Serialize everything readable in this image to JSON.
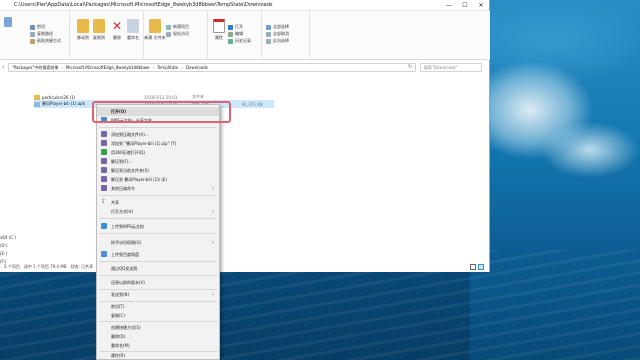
{
  "window": {
    "title": "C:\\Users\\Pier\\AppData\\Local\\Packages\\Microsoft.MicrosoftEdge_8wekyb3d8bbwe\\TempState\\Downloads",
    "min": "—",
    "max": "☐",
    "close": "✕"
  },
  "ribbon": {
    "clipboard_small": [
      "剪切",
      "复制路径",
      "粘贴快捷方式"
    ],
    "move_to": "移动到",
    "copy_to": "复制到",
    "delete": "删除",
    "rename": "重命名",
    "new_folder": "新建\n文件夹",
    "new_small": [
      "新建项目",
      "轻松访问"
    ],
    "properties": "属性",
    "open_small": [
      "打开",
      "编辑",
      "历史记录"
    ],
    "select_small": [
      "全部选择",
      "全部取消",
      "反向选择"
    ],
    "colors": {
      "delete": "#d42a2a",
      "folder": "#e8b84a",
      "accent": "#2b7cd3"
    }
  },
  "address": {
    "crumbs": [
      "\"Packages\"中的搜索结果",
      "Microsoft.MicrosoftEdge_8wekyb3d8bbwe",
      "TempState",
      "Downloads"
    ],
    "search_placeholder": "搜索\"Downloads\""
  },
  "files": [
    {
      "name": "particulars26 (1)",
      "date": "2019/3/12 20:03",
      "type": "文件夹",
      "size": "",
      "selected": false
    },
    {
      "name": "暴风Player-bili (1).apk",
      "date": "2019/3/26 14:29",
      "type": "APK 文件",
      "size": "81,371 KB",
      "selected": true
    }
  ],
  "navpane": [
    "x64 (C:)",
    "(D:)",
    "(E:)",
    "(F:)"
  ],
  "status": {
    "count": "2 个项目",
    "selected": "选中 1 个项目  79.4 MB",
    "state": "状态: 已共享"
  },
  "context_menu": {
    "items": [
      {
        "label": "打开(O)",
        "bold": true,
        "hl": true
      },
      {
        "label": "WPS云文档 - 分享文件"
      },
      {
        "label": "添加到压缩文件(A)..."
      },
      {
        "label": "添加到 \"暴风Player-bili (1).zip\" (T)"
      },
      {
        "label": "用360压缩打开(Q)"
      },
      {
        "label": "解压到(F)..."
      },
      {
        "label": "解压到当前文件夹(X)"
      },
      {
        "label": "解压到 暴风Player-bili (1)\\ (E)"
      },
      {
        "label": "其他压缩命令",
        "sub": true
      },
      {
        "label": "共享"
      },
      {
        "label": "打开方式(H)",
        "sub": true
      },
      {
        "label": "上传到WPS云文档"
      },
      {
        "label": "授予访问权限(G)",
        "sub": true
      },
      {
        "label": "上传到百度网盘"
      },
      {
        "label": "通过QQ发送到"
      },
      {
        "label": "还原以前的版本(V)"
      },
      {
        "label": "发送到(N)",
        "sub": true
      },
      {
        "label": "剪切(T)"
      },
      {
        "label": "复制(C)"
      },
      {
        "label": "创建快捷方式(S)"
      },
      {
        "label": "删除(D)"
      },
      {
        "label": "重命名(M)"
      },
      {
        "label": "属性(R)"
      }
    ]
  }
}
